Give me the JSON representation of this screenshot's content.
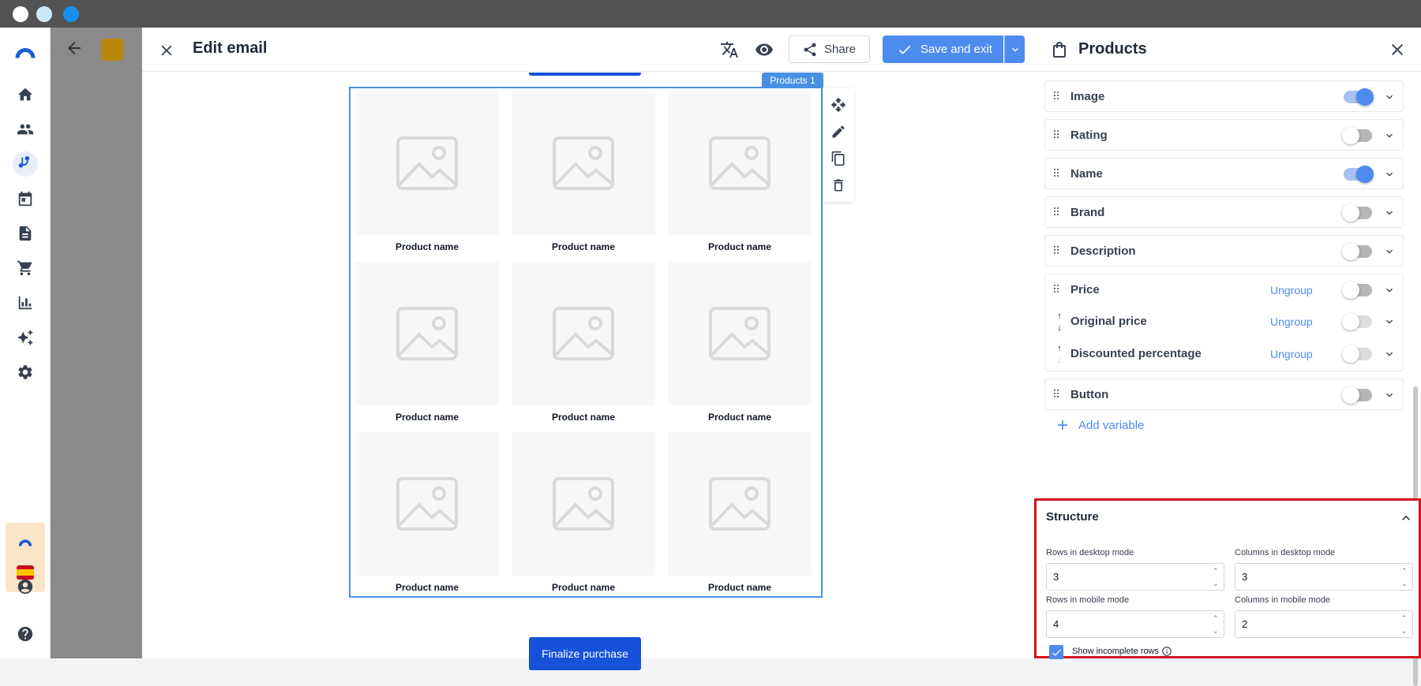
{
  "colors": {
    "accent": "#4e8bee",
    "primary_button": "#1652d9",
    "highlight_border": "#d4141c",
    "titlebar": "#535353"
  },
  "window_controls": [
    "close-dot",
    "minimize-dot",
    "maximize-dot"
  ],
  "app_rail": {
    "icons": [
      "logo-icon",
      "home-icon",
      "contacts-icon",
      "flows-icon",
      "calendar-icon",
      "document-icon",
      "cart-icon",
      "chart-icon",
      "sparkle-icon",
      "settings-icon",
      "account-icon",
      "help-icon"
    ]
  },
  "editor": {
    "title": "Edit email",
    "share_label": "Share",
    "save_label": "Save and exit",
    "block_tag": "Products 1",
    "products": [
      {
        "name": "Product name"
      },
      {
        "name": "Product name"
      },
      {
        "name": "Product name"
      },
      {
        "name": "Product name"
      },
      {
        "name": "Product name"
      },
      {
        "name": "Product name"
      },
      {
        "name": "Product name"
      },
      {
        "name": "Product name"
      },
      {
        "name": "Product name"
      }
    ],
    "finalize_label": "Finalize purchase"
  },
  "panel": {
    "title": "Products",
    "properties": {
      "image": {
        "label": "Image",
        "enabled": true
      },
      "rating": {
        "label": "Rating",
        "enabled": false
      },
      "name": {
        "label": "Name",
        "enabled": true
      },
      "brand": {
        "label": "Brand",
        "enabled": false
      },
      "description": {
        "label": "Description",
        "enabled": false
      },
      "price": {
        "label": "Price",
        "ungroup": "Ungroup",
        "enabled": false
      },
      "original_price": {
        "label": "Original price",
        "ungroup": "Ungroup",
        "enabled": false
      },
      "discounted_percentage": {
        "label": "Discounted percentage",
        "ungroup": "Ungroup",
        "enabled": false
      },
      "button": {
        "label": "Button",
        "enabled": false
      }
    },
    "add_variable_label": "Add variable",
    "structure": {
      "title": "Structure",
      "rows_desktop_label": "Rows in desktop mode",
      "rows_desktop_value": "3",
      "cols_desktop_label": "Columns in desktop mode",
      "cols_desktop_value": "3",
      "rows_mobile_label": "Rows in mobile mode",
      "rows_mobile_value": "4",
      "cols_mobile_label": "Columns in mobile mode",
      "cols_mobile_value": "2",
      "show_incomplete_label": "Show incomplete rows",
      "show_incomplete_checked": true
    }
  }
}
